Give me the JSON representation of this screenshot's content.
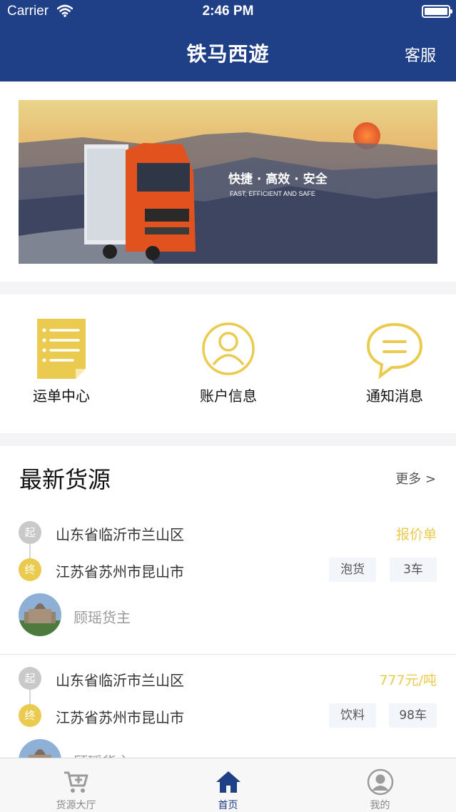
{
  "status_bar": {
    "carrier": "Carrier",
    "time": "2:46 PM"
  },
  "nav": {
    "title": "铁马西遊",
    "service": "客服"
  },
  "banner": {
    "headline": "快捷 · 高效 · 安全",
    "sub": "FAST, EFFICIENT AND SAFE"
  },
  "quick_actions": [
    {
      "label": "运单中心",
      "icon": "clipboard-list-icon"
    },
    {
      "label": "账户信息",
      "icon": "user-circle-icon"
    },
    {
      "label": "通知消息",
      "icon": "chat-bubble-icon"
    }
  ],
  "latest": {
    "title": "最新货源",
    "more": "更多 >",
    "cards": [
      {
        "start_badge": "起",
        "end_badge": "终",
        "from": "山东省临沂市兰山区",
        "to": "江苏省苏州市昆山市",
        "price": "报价单",
        "tags": [
          "泡货",
          "3车"
        ],
        "owner": "顾瑶货主"
      },
      {
        "start_badge": "起",
        "end_badge": "终",
        "from": "山东省临沂市兰山区",
        "to": "江苏省苏州市昆山市",
        "price": "777元/吨",
        "tags": [
          "饮料",
          "98车"
        ],
        "owner": "顾瑶货主"
      }
    ]
  },
  "tabbar": [
    {
      "label": "货源大厅",
      "icon": "cart-plus-icon",
      "active": false
    },
    {
      "label": "首页",
      "icon": "home-icon",
      "active": true
    },
    {
      "label": "我的",
      "icon": "user-avatar-icon",
      "active": false
    }
  ],
  "colors": {
    "primary": "#1f3f87",
    "accent": "#ebcb4f",
    "muted": "#9a9a9a"
  }
}
